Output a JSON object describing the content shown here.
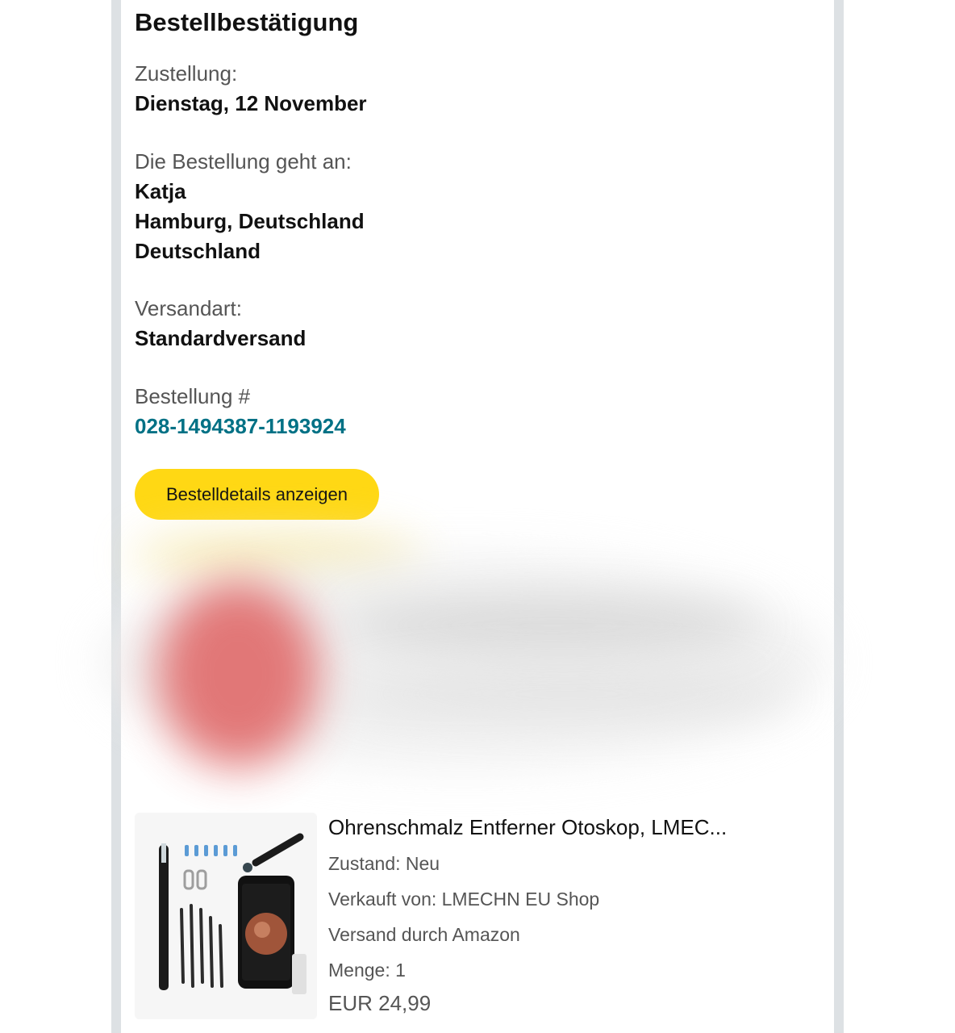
{
  "header": {
    "title": "Bestellbestätigung"
  },
  "delivery": {
    "label": "Zustellung:",
    "value": "Dienstag, 12 November"
  },
  "recipient": {
    "label": "Die Bestellung geht an:",
    "name": "Katja",
    "city": "Hamburg, Deutschland",
    "country": "Deutschland"
  },
  "shipping": {
    "label": "Versandart:",
    "value": "Standardversand"
  },
  "order": {
    "label": "Bestellung #",
    "number": "028-1494387-1193924"
  },
  "actions": {
    "details_button": "Bestelldetails anzeigen"
  },
  "product": {
    "title": "Ohrenschmalz Entferner Otoskop, LMEC...",
    "condition": "Zustand: Neu",
    "seller": "Verkauft von: LMECHN EU Shop",
    "fulfilment": "Versand durch Amazon",
    "quantity": "Menge: 1",
    "price": "EUR 24,99",
    "image_icon": "otoscope-product-image"
  },
  "colors": {
    "accent_button": "#ffd814",
    "link": "#007185",
    "rail": "#dde1e4"
  }
}
